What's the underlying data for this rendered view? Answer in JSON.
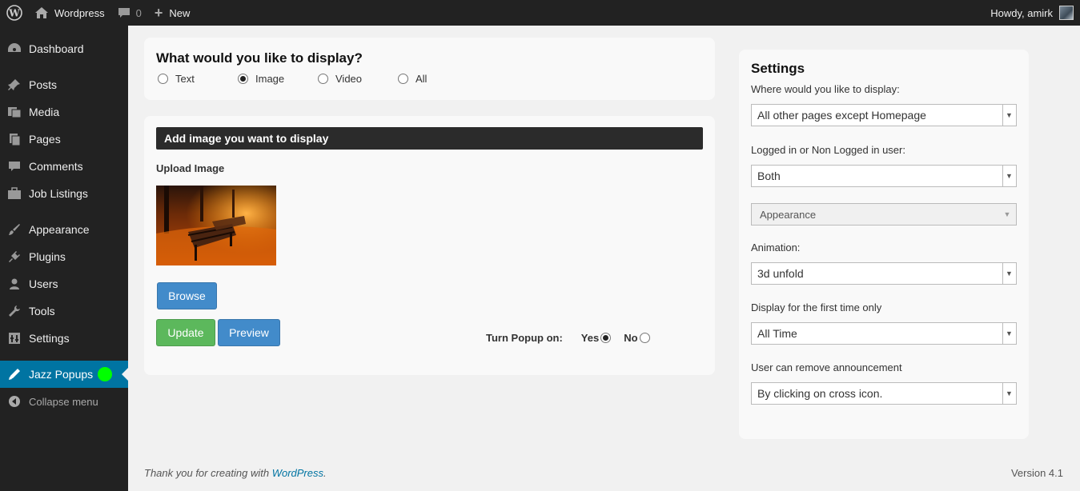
{
  "adminbar": {
    "site_name": "Wordpress",
    "comments_count": "0",
    "new_label": "New",
    "howdy": "Howdy, amirk"
  },
  "sidebar": {
    "items": [
      {
        "label": "Dashboard",
        "icon": "dashboard-icon"
      },
      {
        "label": "Posts",
        "icon": "pin-icon"
      },
      {
        "label": "Media",
        "icon": "media-icon"
      },
      {
        "label": "Pages",
        "icon": "pages-icon"
      },
      {
        "label": "Comments",
        "icon": "comment-icon"
      },
      {
        "label": "Job Listings",
        "icon": "briefcase-icon"
      },
      {
        "label": "Appearance",
        "icon": "brush-icon"
      },
      {
        "label": "Plugins",
        "icon": "plug-icon"
      },
      {
        "label": "Users",
        "icon": "user-icon"
      },
      {
        "label": "Tools",
        "icon": "wrench-icon"
      },
      {
        "label": "Settings",
        "icon": "settings-icon"
      },
      {
        "label": "Jazz Popups",
        "icon": "pen-icon"
      }
    ],
    "collapse_label": "Collapse menu"
  },
  "display": {
    "heading": "What would you like to display?",
    "options": [
      "Text",
      "Image",
      "Video",
      "All"
    ],
    "selected": "Image"
  },
  "image_panel": {
    "heading": "Add image you want to display",
    "upload_label": "Upload Image",
    "browse_label": "Browse",
    "update_label": "Update",
    "preview_label": "Preview",
    "turn_popup_label": "Turn Popup on:",
    "yes_label": "Yes",
    "no_label": "No",
    "turn_popup_value": "Yes"
  },
  "settings": {
    "title": "Settings",
    "where_label": "Where would you like to display:",
    "where_value": "All other pages except Homepage",
    "logged_label": "Logged in or Non Logged in user:",
    "logged_value": "Both",
    "appearance_value": "Appearance",
    "animation_label": "Animation:",
    "animation_value": "3d unfold",
    "first_time_label": "Display for the first time only",
    "first_time_value": "All Time",
    "remove_label": "User can remove announcement",
    "remove_value": "By clicking on cross icon."
  },
  "footer": {
    "thanks_prefix": "Thank you for creating with ",
    "thanks_link": "WordPress",
    "thanks_suffix": ".",
    "version": "Version 4.1"
  },
  "colors": {
    "admin_bg": "#222222",
    "active_menu": "#0074a2",
    "primary_button": "#428bca",
    "success_button": "#5cb85c",
    "status_dot": "#00ff00"
  }
}
